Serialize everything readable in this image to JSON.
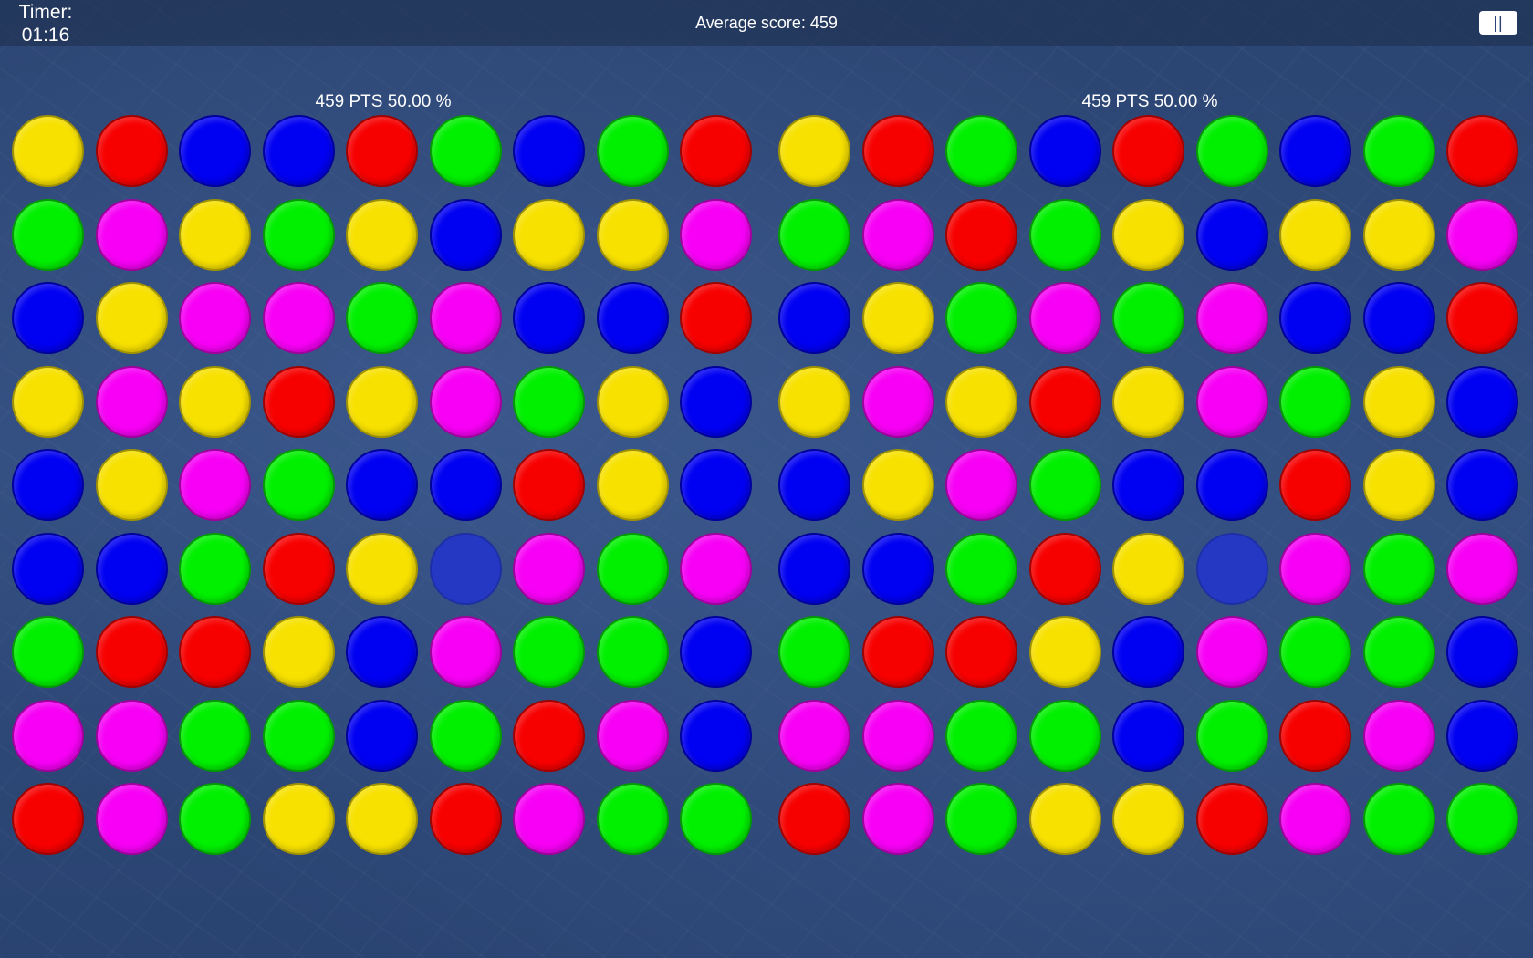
{
  "header": {
    "timer_label": "Timer:",
    "timer_value": "01:16",
    "average_score": "Average score: 459",
    "pause_label": "||"
  },
  "colors": {
    "Y": "#f7e100",
    "R": "#f70000",
    "B": "#0000f2",
    "G": "#00f000",
    "M": "#f700f5",
    "D": "#2438c4"
  },
  "boards": [
    {
      "label": "459 PTS 50.00 %",
      "grid": [
        [
          "Y",
          "R",
          "B",
          "B",
          "R",
          "G",
          "B",
          "G",
          "R"
        ],
        [
          "G",
          "M",
          "Y",
          "G",
          "Y",
          "B",
          "Y",
          "Y",
          "M"
        ],
        [
          "B",
          "Y",
          "M",
          "M",
          "G",
          "M",
          "B",
          "B",
          "R"
        ],
        [
          "Y",
          "M",
          "Y",
          "R",
          "Y",
          "M",
          "G",
          "Y",
          "B"
        ],
        [
          "B",
          "Y",
          "M",
          "G",
          "B",
          "B",
          "R",
          "Y",
          "B"
        ],
        [
          "B",
          "B",
          "G",
          "R",
          "Y",
          "D",
          "M",
          "G",
          "M"
        ],
        [
          "G",
          "R",
          "R",
          "Y",
          "B",
          "M",
          "G",
          "G",
          "B"
        ],
        [
          "M",
          "M",
          "G",
          "G",
          "B",
          "G",
          "R",
          "M",
          "B"
        ],
        [
          "R",
          "M",
          "G",
          "Y",
          "Y",
          "R",
          "M",
          "G",
          "G"
        ]
      ]
    },
    {
      "label": "459 PTS 50.00 %",
      "grid": [
        [
          "Y",
          "R",
          "G",
          "B",
          "R",
          "G",
          "B",
          "G",
          "R"
        ],
        [
          "G",
          "M",
          "R",
          "G",
          "Y",
          "B",
          "Y",
          "Y",
          "M"
        ],
        [
          "B",
          "Y",
          "G",
          "M",
          "G",
          "M",
          "B",
          "B",
          "R"
        ],
        [
          "Y",
          "M",
          "Y",
          "R",
          "Y",
          "M",
          "G",
          "Y",
          "B"
        ],
        [
          "B",
          "Y",
          "M",
          "G",
          "B",
          "B",
          "R",
          "Y",
          "B"
        ],
        [
          "B",
          "B",
          "G",
          "R",
          "Y",
          "D",
          "M",
          "G",
          "M"
        ],
        [
          "G",
          "R",
          "R",
          "Y",
          "B",
          "M",
          "G",
          "G",
          "B"
        ],
        [
          "M",
          "M",
          "G",
          "G",
          "B",
          "G",
          "R",
          "M",
          "B"
        ],
        [
          "R",
          "M",
          "G",
          "Y",
          "Y",
          "R",
          "M",
          "G",
          "G"
        ]
      ]
    }
  ]
}
